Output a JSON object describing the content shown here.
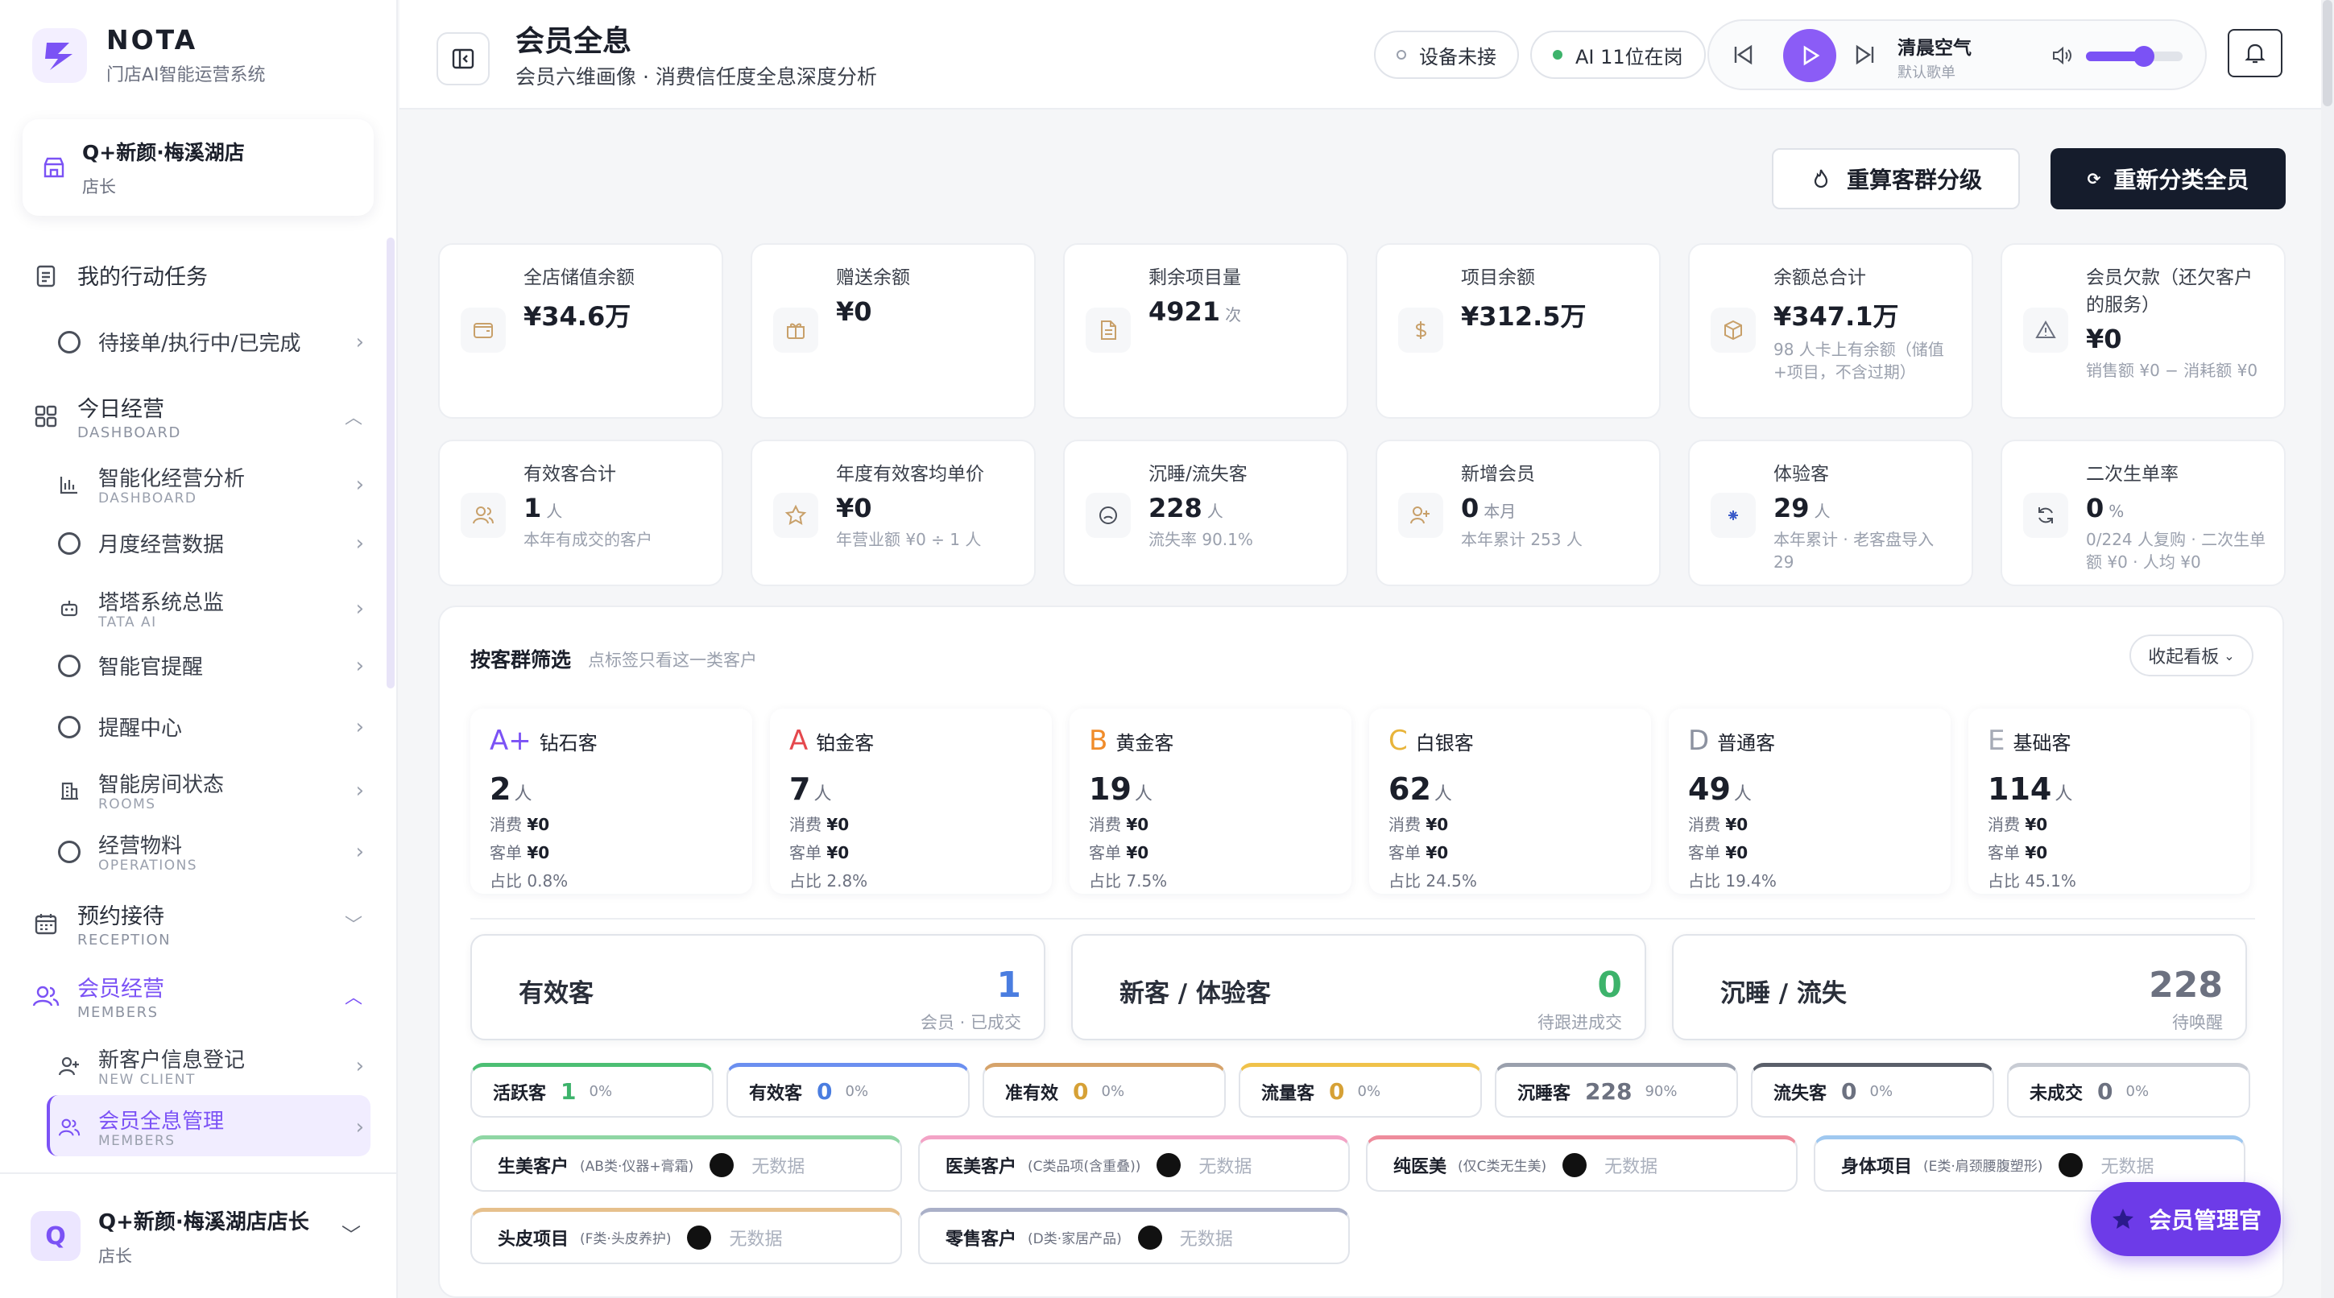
{
  "brand": {
    "name": "NOTA",
    "subtitle": "门店AI智能运营系统"
  },
  "store": {
    "name": "Q+新颜·梅溪湖店",
    "role": "店长"
  },
  "nav": {
    "tasks": {
      "label": "我的行动任务",
      "sub": "待接单/执行中/已完成"
    },
    "today": {
      "label": "今日经营",
      "en": "DASHBOARD",
      "items": [
        {
          "label": "智能化经营分析",
          "en": "DASHBOARD"
        },
        {
          "label": "月度经营数据",
          "en": ""
        },
        {
          "label": "塔塔系统总监",
          "en": "TATA AI"
        },
        {
          "label": "智能官提醒",
          "en": ""
        },
        {
          "label": "提醒中心",
          "en": ""
        },
        {
          "label": "智能房间状态",
          "en": "ROOMS"
        },
        {
          "label": "经营物料",
          "en": "OPERATIONS"
        }
      ]
    },
    "reception": {
      "label": "预约接待",
      "en": "RECEPTION"
    },
    "members": {
      "label": "会员经营",
      "en": "MEMBERS",
      "items": [
        {
          "label": "新客户信息登记",
          "en": "NEW CLIENT"
        },
        {
          "label": "会员全息管理",
          "en": "MEMBERS"
        }
      ]
    }
  },
  "user": {
    "initial": "Q",
    "name": "Q+新颜·梅溪湖店店长",
    "role": "店长"
  },
  "header": {
    "title": "会员全息",
    "subtitle": "会员六维画像 · 消费信任度全息深度分析",
    "device": "设备未接",
    "ai": "AI 11位在岗"
  },
  "player": {
    "song": "清晨空气",
    "playlist": "默认歌单",
    "volume": 0.6
  },
  "actions": {
    "recalc": "重算客群分级",
    "reclassify": "重新分类全员"
  },
  "stats_row1": [
    {
      "label": "全店储值余额",
      "value": "¥34.6万",
      "unit": "",
      "note": "",
      "icon": "wallet-icon"
    },
    {
      "label": "赠送余额",
      "value": "¥0",
      "unit": "",
      "note": "",
      "icon": "gift-icon"
    },
    {
      "label": "剩余项目量",
      "value": "4921",
      "unit": "次",
      "note": "",
      "icon": "document-icon"
    },
    {
      "label": "项目余额",
      "value": "¥312.5万",
      "unit": "",
      "note": "",
      "icon": "dollar-icon"
    },
    {
      "label": "余额总合计",
      "value": "¥347.1万",
      "unit": "",
      "note": "98 人卡上有余额（储值+项目，不含过期）",
      "icon": "box-icon"
    },
    {
      "label": "会员欠款（还欠客户的服务）",
      "value": "¥0",
      "unit": "",
      "note": "销售额 ¥0 − 消耗额 ¥0",
      "icon": "warning-icon"
    }
  ],
  "stats_row2": [
    {
      "label": "有效客合计",
      "value": "1",
      "unit": "人",
      "note": "本年有成交的客户",
      "icon": "users-icon"
    },
    {
      "label": "年度有效客均单价",
      "value": "¥0",
      "unit": "",
      "note": "年营业额 ¥0 ÷ 1 人",
      "icon": "star-icon"
    },
    {
      "label": "沉睡/流失客",
      "value": "228",
      "unit": "人",
      "note": "流失率 90.1%",
      "icon": "sad-face-icon"
    },
    {
      "label": "新增会员",
      "value": "0",
      "unit": "本月",
      "note": "本年累计 253 人",
      "icon": "user-plus-icon"
    },
    {
      "label": "体验客",
      "value": "29",
      "unit": "人",
      "note": "本年累计 · 老客盘导入 29",
      "icon": "sparkle-icon"
    },
    {
      "label": "二次生单率",
      "value": "0",
      "unit": "%",
      "note": "0/224 人复购 · 二次生单额 ¥0 · 人均 ¥0",
      "icon": "refresh-icon"
    }
  ],
  "filter": {
    "title": "按客群筛选",
    "hint": "点标签只看这一类客户",
    "collapse": "收起看板"
  },
  "tiers": [
    {
      "letter": "A+",
      "name": "钻石客",
      "count": "2",
      "unit": "人",
      "spend_label": "消费",
      "spend": "¥0",
      "avg_label": "客单",
      "avg": "¥0",
      "share": "占比 0.8%",
      "color": "#7b52f5"
    },
    {
      "letter": "A",
      "name": "铂金客",
      "count": "7",
      "unit": "人",
      "spend_label": "消费",
      "spend": "¥0",
      "avg_label": "客单",
      "avg": "¥0",
      "share": "占比 2.8%",
      "color": "#e5484d"
    },
    {
      "letter": "B",
      "name": "黄金客",
      "count": "19",
      "unit": "人",
      "spend_label": "消费",
      "spend": "¥0",
      "avg_label": "客单",
      "avg": "¥0",
      "share": "占比 7.5%",
      "color": "#f08c2a"
    },
    {
      "letter": "C",
      "name": "白银客",
      "count": "62",
      "unit": "人",
      "spend_label": "消费",
      "spend": "¥0",
      "avg_label": "客单",
      "avg": "¥0",
      "share": "占比 24.5%",
      "color": "#e8b43a"
    },
    {
      "letter": "D",
      "name": "普通客",
      "count": "49",
      "unit": "人",
      "spend_label": "消费",
      "spend": "¥0",
      "avg_label": "客单",
      "avg": "¥0",
      "share": "占比 19.4%",
      "color": "#8c92a0"
    },
    {
      "letter": "E",
      "name": "基础客",
      "count": "114",
      "unit": "人",
      "spend_label": "消费",
      "spend": "¥0",
      "avg_label": "客单",
      "avg": "¥0",
      "share": "占比 45.1%",
      "color": "#a6abb6"
    }
  ],
  "summary": [
    {
      "title": "有效客",
      "value": "1",
      "sub": "会员 · 已成交",
      "color": "#4a7de0"
    },
    {
      "title": "新客 / 体验客",
      "value": "0",
      "sub": "待跟进成交",
      "color": "#3db36b"
    },
    {
      "title": "沉睡 / 流失",
      "value": "228",
      "sub": "待唤醒",
      "color": "#6c7180"
    }
  ],
  "status_chips": [
    {
      "label": "活跃客",
      "value": "1",
      "pct": "0%",
      "color": "#4cbf74"
    },
    {
      "label": "有效客",
      "value": "0",
      "pct": "0%",
      "color": "#6b8ff0"
    },
    {
      "label": "准有效",
      "value": "0",
      "pct": "0%",
      "color": "#d6a36a"
    },
    {
      "label": "流量客",
      "value": "0",
      "pct": "0%",
      "color": "#f0c24a"
    },
    {
      "label": "沉睡客",
      "value": "228",
      "pct": "90%",
      "color": "#9aa0ad"
    },
    {
      "label": "流失客",
      "value": "0",
      "pct": "0%",
      "color": "#5a5f6a"
    },
    {
      "label": "未成交",
      "value": "0",
      "pct": "0%",
      "color": "#c8ccd4"
    }
  ],
  "categories": [
    {
      "label": "生美客户",
      "desc": "(AB类·仪器+膏霜)",
      "nodata": "无数据",
      "color": "#8fd6a4"
    },
    {
      "label": "医美客户",
      "desc": "(C类品项(含重叠))",
      "nodata": "无数据",
      "color": "#f3a3c6"
    },
    {
      "label": "纯医美",
      "desc": "(仅C类无生美)",
      "nodata": "无数据",
      "color": "#ee8c9c"
    },
    {
      "label": "身体项目",
      "desc": "(E类·肩颈腰腹塑形)",
      "nodata": "无数据",
      "color": "#9fc8f0"
    },
    {
      "label": "头皮项目",
      "desc": "(F类·头皮养护)",
      "nodata": "无数据",
      "color": "#e6c08c"
    },
    {
      "label": "零售客户",
      "desc": "(D类·家居产品)",
      "nodata": "无数据",
      "color": "#aab0c8"
    }
  ],
  "fab": {
    "label": "会员管理官"
  }
}
